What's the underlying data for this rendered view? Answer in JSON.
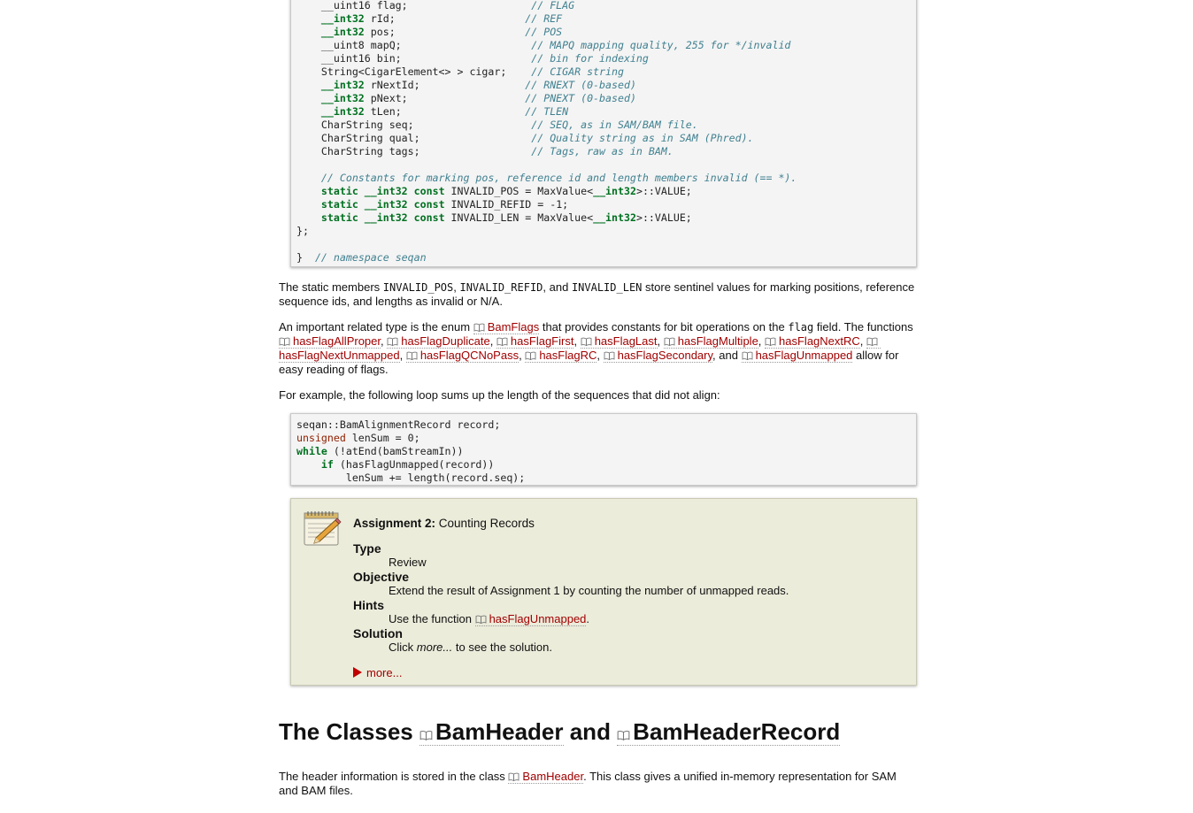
{
  "code1": {
    "lines": [
      {
        "segs": [
          {
            "t": "    __uint16 flag;                    "
          },
          {
            "c": "cm",
            "t": "// FLAG"
          }
        ]
      },
      {
        "segs": [
          {
            "t": "    "
          },
          {
            "c": "kw",
            "t": "__int32"
          },
          {
            "t": " rId;                     "
          },
          {
            "c": "cm",
            "t": "// REF"
          }
        ]
      },
      {
        "segs": [
          {
            "t": "    "
          },
          {
            "c": "kw",
            "t": "__int32"
          },
          {
            "t": " pos;                     "
          },
          {
            "c": "cm",
            "t": "// POS"
          }
        ]
      },
      {
        "segs": [
          {
            "t": "    __uint8 mapQ;                     "
          },
          {
            "c": "cm",
            "t": "// MAPQ mapping quality, 255 for */invalid"
          }
        ]
      },
      {
        "segs": [
          {
            "t": "    __uint16 bin;                     "
          },
          {
            "c": "cm",
            "t": "// bin for indexing"
          }
        ]
      },
      {
        "segs": [
          {
            "t": "    String<CigarElement<> > cigar;    "
          },
          {
            "c": "cm",
            "t": "// CIGAR string"
          }
        ]
      },
      {
        "segs": [
          {
            "t": "    "
          },
          {
            "c": "kw",
            "t": "__int32"
          },
          {
            "t": " rNextId;                 "
          },
          {
            "c": "cm",
            "t": "// RNEXT (0-based)"
          }
        ]
      },
      {
        "segs": [
          {
            "t": "    "
          },
          {
            "c": "kw",
            "t": "__int32"
          },
          {
            "t": " pNext;                   "
          },
          {
            "c": "cm",
            "t": "// PNEXT (0-based)"
          }
        ]
      },
      {
        "segs": [
          {
            "t": "    "
          },
          {
            "c": "kw",
            "t": "__int32"
          },
          {
            "t": " tLen;                    "
          },
          {
            "c": "cm",
            "t": "// TLEN"
          }
        ]
      },
      {
        "segs": [
          {
            "t": "    CharString seq;                   "
          },
          {
            "c": "cm",
            "t": "// SEQ, as in SAM/BAM file."
          }
        ]
      },
      {
        "segs": [
          {
            "t": "    CharString qual;                  "
          },
          {
            "c": "cm",
            "t": "// Quality string as in SAM (Phred)."
          }
        ]
      },
      {
        "segs": [
          {
            "t": "    CharString tags;                  "
          },
          {
            "c": "cm",
            "t": "// Tags, raw as in BAM."
          }
        ]
      },
      {
        "segs": [
          {
            "t": ""
          }
        ]
      },
      {
        "segs": [
          {
            "t": "    "
          },
          {
            "c": "cm",
            "t": "// Constants for marking pos, reference id and length members invalid (== *)."
          }
        ]
      },
      {
        "segs": [
          {
            "t": "    "
          },
          {
            "c": "kw",
            "t": "static"
          },
          {
            "t": " "
          },
          {
            "c": "kw",
            "t": "__int32"
          },
          {
            "t": " "
          },
          {
            "c": "kw",
            "t": "const"
          },
          {
            "t": " INVALID_POS = MaxValue<"
          },
          {
            "c": "kw",
            "t": "__int32"
          },
          {
            "t": ">::VALUE;"
          }
        ]
      },
      {
        "segs": [
          {
            "t": "    "
          },
          {
            "c": "kw",
            "t": "static"
          },
          {
            "t": " "
          },
          {
            "c": "kw",
            "t": "__int32"
          },
          {
            "t": " "
          },
          {
            "c": "kw",
            "t": "const"
          },
          {
            "t": " INVALID_REFID = -1;"
          }
        ]
      },
      {
        "segs": [
          {
            "t": "    "
          },
          {
            "c": "kw",
            "t": "static"
          },
          {
            "t": " "
          },
          {
            "c": "kw",
            "t": "__int32"
          },
          {
            "t": " "
          },
          {
            "c": "kw",
            "t": "const"
          },
          {
            "t": " INVALID_LEN = MaxValue<"
          },
          {
            "c": "kw",
            "t": "__int32"
          },
          {
            "t": ">::VALUE;"
          }
        ]
      },
      {
        "segs": [
          {
            "t": "};"
          }
        ]
      },
      {
        "segs": [
          {
            "t": ""
          }
        ]
      },
      {
        "segs": [
          {
            "t": "}  "
          },
          {
            "c": "cm",
            "t": "// namespace seqan"
          }
        ]
      }
    ]
  },
  "para1": {
    "t1": "The static members ",
    "m1": "INVALID_POS",
    "t2": ", ",
    "m2": "INVALID_REFID",
    "t3": ", and ",
    "m3": "INVALID_LEN",
    "t4": " store sentinel values for marking positions, reference sequence ids, and lengths as invalid or N/A."
  },
  "para2": {
    "t1": "An important related type is the enum ",
    "bamflags": "BamFlags",
    "t2": " that provides constants for bit operations on the ",
    "flag": "flag",
    "t3": " field. The functions ",
    "funcs": [
      "hasFlagAllProper",
      "hasFlagDuplicate",
      "hasFlagFirst",
      "hasFlagLast",
      "hasFlagMultiple",
      "hasFlagNextRC",
      "hasFlagNextUnmapped",
      "hasFlagQCNoPass",
      "hasFlagRC",
      "hasFlagSecondary"
    ],
    "sep": ", ",
    "and": ", and ",
    "last": "hasFlagUnmapped",
    "t4": " allow for easy reading of flags."
  },
  "para3": "For example, the following loop sums up the length of the sequences that did not align:",
  "code2": {
    "lines": [
      {
        "segs": [
          {
            "t": "seqan::BamAlignmentRecord record;"
          }
        ]
      },
      {
        "segs": [
          {
            "c": "ty",
            "t": "unsigned"
          },
          {
            "t": " lenSum = 0;"
          }
        ]
      },
      {
        "segs": [
          {
            "c": "kw",
            "t": "while"
          },
          {
            "t": " (!atEnd(bamStreamIn))"
          }
        ]
      },
      {
        "segs": [
          {
            "t": "    "
          },
          {
            "c": "kw",
            "t": "if"
          },
          {
            "t": " (hasFlagUnmapped(record))"
          }
        ]
      },
      {
        "segs": [
          {
            "t": "        lenSum += length(record.seq);"
          }
        ]
      }
    ]
  },
  "assignment": {
    "label": "Assignment 2:",
    "title": "Counting Records",
    "type_label": "Type",
    "type_value": "Review",
    "objective_label": "Objective",
    "objective_value": "Extend the result of Assignment 1 by counting the number of unmapped reads.",
    "hints_label": "Hints",
    "hints_prefix": "Use the function ",
    "hints_link": "hasFlagUnmapped",
    "hints_suffix": ".",
    "solution_label": "Solution",
    "solution_prefix": "Click ",
    "solution_em": "more...",
    "solution_suffix": " to see the solution.",
    "more_label": "more..."
  },
  "heading": {
    "prefix": "The Classes ",
    "link1": "BamHeader",
    "mid": " and ",
    "link2": "BamHeaderRecord"
  },
  "para4": {
    "t1": "The header information is stored in the class ",
    "link": "BamHeader",
    "t2": ". This class gives a unified in-memory representation for SAM and BAM files."
  }
}
